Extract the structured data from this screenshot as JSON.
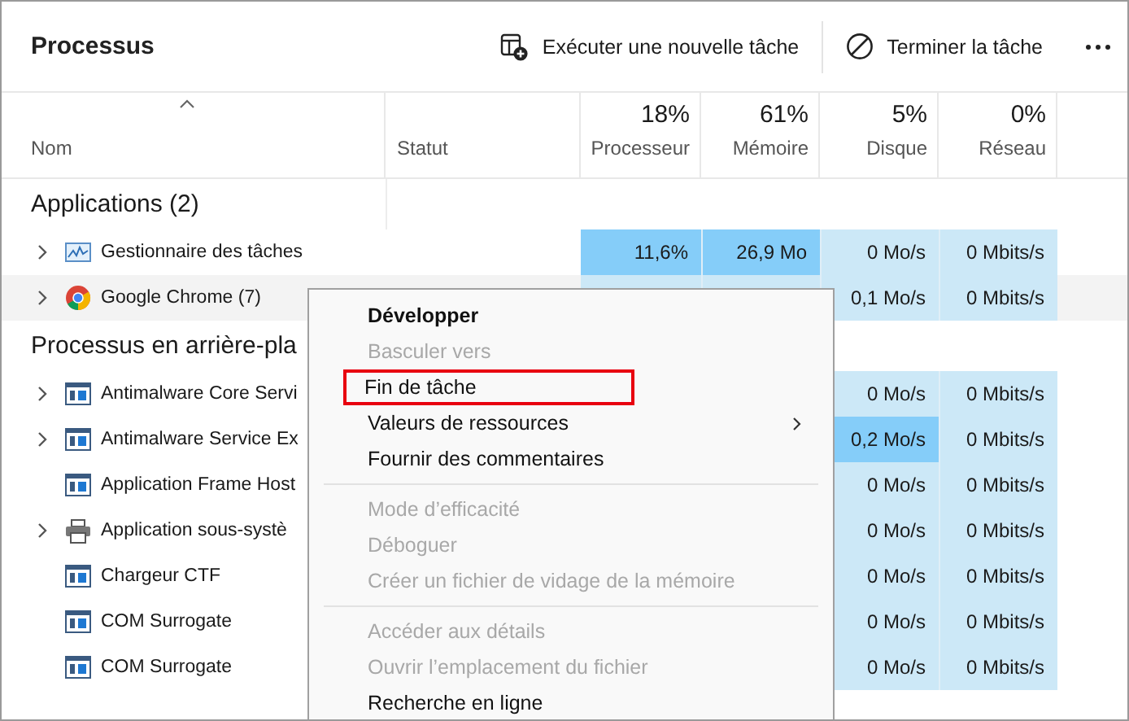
{
  "title": "Processus",
  "toolbar": [
    {
      "kind": "run",
      "label": "Exécuter une nouvelle tâche"
    },
    {
      "kind": "end",
      "label": "Terminer la tâche"
    },
    {
      "kind": "more"
    }
  ],
  "columns": [
    {
      "label": "Nom"
    },
    {
      "label": "Statut"
    },
    {
      "label": "Processeur",
      "percent": "18%"
    },
    {
      "label": "Mémoire",
      "percent": "61%"
    },
    {
      "label": "Disque",
      "percent": "5%"
    },
    {
      "label": "Réseau",
      "percent": "0%"
    }
  ],
  "groups": [
    {
      "title": "Applications (2)",
      "rows": [
        {
          "name": "Gestionnaire des tâches",
          "kind": "monitor",
          "expandable": true,
          "hovered": false,
          "cpu": {
            "text": "11,6%",
            "busy": true
          },
          "memory": {
            "text": "26,9 Mo",
            "busy": true
          },
          "disk": {
            "text": "0 Mo/s",
            "busy": false
          },
          "network": {
            "text": "0 Mbits/s",
            "busy": false
          }
        },
        {
          "name": "Google Chrome (7)",
          "kind": "browser",
          "expandable": true,
          "hovered": true,
          "disk": {
            "text": "0,1 Mo/s",
            "busy": false
          },
          "network": {
            "text": "0 Mbits/s",
            "busy": false
          }
        }
      ]
    },
    {
      "title": "Processus en arrière-pla",
      "rows": [
        {
          "name": "Antimalware Core Servi",
          "kind": "app",
          "expandable": true,
          "hovered": false,
          "disk": {
            "text": "0 Mo/s",
            "busy": false
          },
          "network": {
            "text": "0 Mbits/s",
            "busy": false
          }
        },
        {
          "name": "Antimalware Service Ex",
          "kind": "app",
          "expandable": true,
          "hovered": false,
          "disk": {
            "text": "0,2 Mo/s",
            "busy": true
          },
          "network": {
            "text": "0 Mbits/s",
            "busy": false
          }
        },
        {
          "name": "Application Frame Host",
          "kind": "app",
          "expandable": false,
          "hovered": false,
          "disk": {
            "text": "0 Mo/s",
            "busy": false
          },
          "network": {
            "text": "0 Mbits/s",
            "busy": false
          }
        },
        {
          "name": "Application sous-systè",
          "kind": "printer",
          "expandable": true,
          "hovered": false,
          "disk": {
            "text": "0 Mo/s",
            "busy": false
          },
          "network": {
            "text": "0 Mbits/s",
            "busy": false
          }
        },
        {
          "name": "Chargeur CTF",
          "kind": "app",
          "expandable": false,
          "hovered": false,
          "disk": {
            "text": "0 Mo/s",
            "busy": false
          },
          "network": {
            "text": "0 Mbits/s",
            "busy": false
          }
        },
        {
          "name": "COM Surrogate",
          "kind": "app",
          "expandable": false,
          "hovered": false,
          "disk": {
            "text": "0 Mo/s",
            "busy": false
          },
          "network": {
            "text": "0 Mbits/s",
            "busy": false
          }
        },
        {
          "name": "COM Surrogate",
          "kind": "app",
          "expandable": false,
          "hovered": false,
          "disk": {
            "text": "0 Mo/s",
            "busy": false
          },
          "network": {
            "text": "0 Mbits/s",
            "busy": false
          }
        }
      ]
    }
  ],
  "context_menu": [
    {
      "kind": "item",
      "label": "Développer",
      "bold": true,
      "disabled": false,
      "submenu": false,
      "highlighted": false
    },
    {
      "kind": "item",
      "label": "Basculer vers",
      "bold": false,
      "disabled": true,
      "submenu": false,
      "highlighted": false
    },
    {
      "kind": "item",
      "label": "Fin de tâche",
      "bold": false,
      "disabled": false,
      "submenu": false,
      "highlighted": true
    },
    {
      "kind": "item",
      "label": "Valeurs de ressources",
      "bold": false,
      "disabled": false,
      "submenu": true,
      "highlighted": false
    },
    {
      "kind": "item",
      "label": "Fournir des commentaires",
      "bold": false,
      "disabled": false,
      "submenu": false,
      "highlighted": false
    },
    {
      "kind": "separator"
    },
    {
      "kind": "item",
      "label": "Mode d’efficacité",
      "bold": false,
      "disabled": true,
      "submenu": false,
      "highlighted": false
    },
    {
      "kind": "item",
      "label": "Déboguer",
      "bold": false,
      "disabled": true,
      "submenu": false,
      "highlighted": false
    },
    {
      "kind": "item",
      "label": "Créer un fichier de vidage de la mémoire",
      "bold": false,
      "disabled": true,
      "submenu": false,
      "highlighted": false
    },
    {
      "kind": "separator"
    },
    {
      "kind": "item",
      "label": "Accéder aux détails",
      "bold": false,
      "disabled": true,
      "submenu": false,
      "highlighted": false
    },
    {
      "kind": "item",
      "label": "Ouvrir l’emplacement du fichier",
      "bold": false,
      "disabled": true,
      "submenu": false,
      "highlighted": false
    },
    {
      "kind": "item",
      "label": "Recherche en ligne",
      "bold": false,
      "disabled": false,
      "submenu": false,
      "highlighted": false
    }
  ]
}
